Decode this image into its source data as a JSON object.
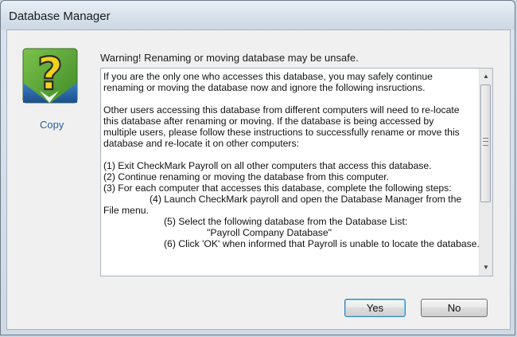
{
  "window": {
    "title": "Database Manager"
  },
  "sidebar": {
    "icon": "help-question-icon",
    "copy_label": "Copy"
  },
  "warning_text": "Warning! Renaming or moving database may be unsafe.",
  "message_lines": [
    "If you are the only one who accesses this database, you may safely continue",
    "renaming or moving the database now and ignore the following insructions.",
    "",
    "Other users accessing this database from different computers will need to re-locate",
    "this database after renaming or moving. If the database is being accessed by",
    "multiple users, please follow these instructions to successfully rename or move this",
    "database and re-locate it on other computers:",
    "",
    "(1) Exit CheckMark Payroll on all other computers that access this database.",
    "(2) Continue renaming or moving the database from this computer.",
    "(3) For each computer that accesses this database, complete the following steps:",
    "(4) Launch CheckMark payroll and open the Database Manager from the",
    "File menu.",
    "(5) Select the following database from the Database List:",
    "\"Payroll Company Database\"",
    "(6) Click 'OK' when informed that Payroll is unable to locate the database."
  ],
  "buttons": {
    "yes": "Yes",
    "no": "No"
  },
  "colors": {
    "accent": "#2a5e96",
    "icon_green": "#5aa53a",
    "icon_yellow": "#f2d31a",
    "icon_blue": "#2b6cb0"
  }
}
